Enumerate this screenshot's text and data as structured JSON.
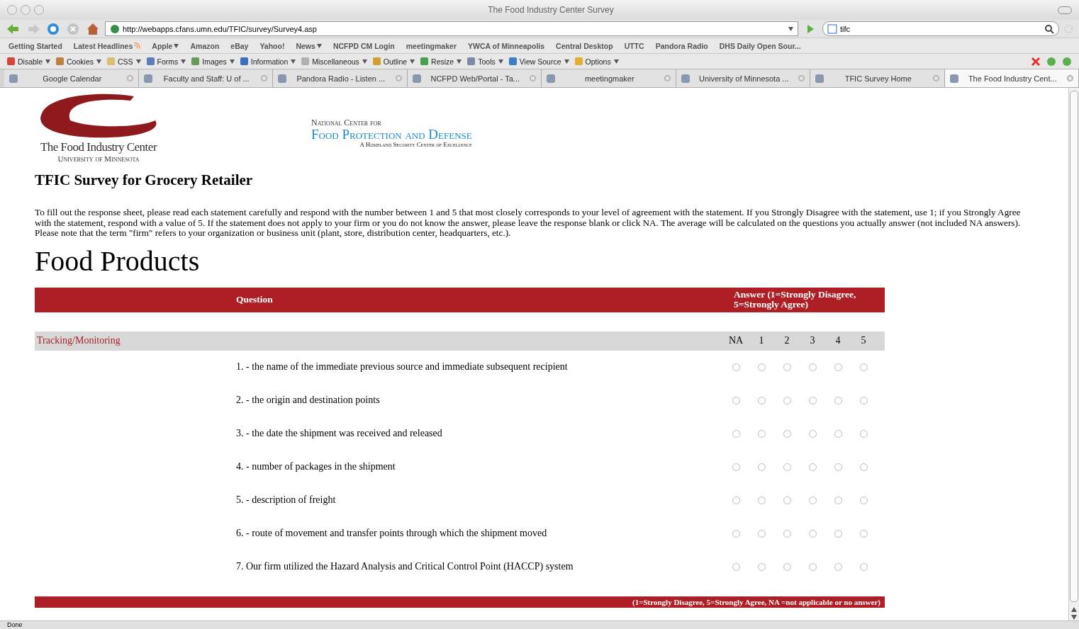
{
  "window": {
    "title": "The Food Industry Center Survey"
  },
  "navbar": {
    "url": "http://webapps.cfans.umn.edu/TFIC/survey/Survey4.asp",
    "search_value": "tifc"
  },
  "bookmarks": [
    {
      "label": "Getting Started",
      "menu": false
    },
    {
      "label": "Latest Headlines",
      "menu": false,
      "feed": true
    },
    {
      "label": "Apple",
      "menu": true
    },
    {
      "label": "Amazon",
      "menu": false
    },
    {
      "label": "eBay",
      "menu": false
    },
    {
      "label": "Yahoo!",
      "menu": false
    },
    {
      "label": "News",
      "menu": true
    },
    {
      "label": "NCFPD CM Login",
      "menu": false
    },
    {
      "label": "meetingmaker",
      "menu": false
    },
    {
      "label": "YWCA of Minneapolis",
      "menu": false
    },
    {
      "label": "Central Desktop",
      "menu": false
    },
    {
      "label": "UTTC",
      "menu": false
    },
    {
      "label": "Pandora Radio",
      "menu": false
    },
    {
      "label": "DHS Daily Open Sour...",
      "menu": false
    }
  ],
  "dev_toolbar": [
    {
      "label": "Disable",
      "color": "#d9443a"
    },
    {
      "label": "Cookies",
      "color": "#c08040"
    },
    {
      "label": "CSS",
      "color": "#d8c070"
    },
    {
      "label": "Forms",
      "color": "#5a7fb8"
    },
    {
      "label": "Images",
      "color": "#6a9a5a"
    },
    {
      "label": "Information",
      "color": "#3a70c0"
    },
    {
      "label": "Miscellaneous",
      "color": "#b0b0b0"
    },
    {
      "label": "Outline",
      "color": "#d0a030"
    },
    {
      "label": "Resize",
      "color": "#4aa050"
    },
    {
      "label": "Tools",
      "color": "#7a8aa8"
    },
    {
      "label": "View Source",
      "color": "#3a80c8"
    },
    {
      "label": "Options",
      "color": "#e0b030"
    }
  ],
  "tabs": [
    {
      "label": "Google Calendar",
      "selected": false
    },
    {
      "label": "Faculty and Staff: U of ...",
      "selected": false
    },
    {
      "label": "Pandora Radio - Listen ...",
      "selected": false
    },
    {
      "label": "NCFPD Web/Portal - Ta...",
      "selected": false
    },
    {
      "label": "meetingmaker",
      "selected": false
    },
    {
      "label": "University of Minnesota ...",
      "selected": false
    },
    {
      "label": "TFIC Survey Home",
      "selected": false
    },
    {
      "label": "The Food Industry Cent...",
      "selected": true
    }
  ],
  "page": {
    "logo_left": {
      "line1": "The Food Industry Center",
      "line2": "University of Minnesota"
    },
    "logo_right": {
      "line1": "National Center for",
      "line2": "Food Protection and Defense",
      "line3": "A Homeland Security Center of Excellence"
    },
    "title": "TFIC Survey for Grocery Retailer",
    "instructions": "To fill out the response sheet, please read each statement carefully and respond with the number between 1 and 5 that most closely corresponds to your level of agreement with the statement. If you Strongly Disagree with the statement, use 1; if you Strongly Agree with the statement, respond with a value of 5. If the statement does not apply to your firm or you do not know the answer, please leave the response blank or click NA. The average will be calculated on the questions you actually answer (not included NA answers). Please note that the term \"firm\" refers to your organization or business unit (plant, store, distribution center, headquarters, etc.).",
    "section": "Food Products",
    "table": {
      "columns": [
        "Question",
        "Answer (1=Strongly Disagree, 5=Strongly Agree)"
      ],
      "category": "Tracking/Monitoring",
      "scale": [
        "NA",
        "1",
        "2",
        "3",
        "4",
        "5"
      ],
      "questions": [
        {
          "text": "1. - the name of the immediate previous source and immediate subsequent recipient",
          "choices": [
            {
              "selected": false
            },
            {
              "selected": false
            },
            {
              "selected": false
            },
            {
              "selected": false
            },
            {
              "selected": false
            },
            {
              "selected": false
            }
          ]
        },
        {
          "text": "2. - the origin and destination points",
          "choices": [
            {
              "selected": false
            },
            {
              "selected": false
            },
            {
              "selected": false
            },
            {
              "selected": false
            },
            {
              "selected": false
            },
            {
              "selected": false
            }
          ]
        },
        {
          "text": "3. - the date the shipment was received and released",
          "choices": [
            {
              "selected": false
            },
            {
              "selected": false
            },
            {
              "selected": false
            },
            {
              "selected": false
            },
            {
              "selected": false
            },
            {
              "selected": false
            }
          ]
        },
        {
          "text": "4. - number of packages in the shipment",
          "choices": [
            {
              "selected": false
            },
            {
              "selected": false
            },
            {
              "selected": false
            },
            {
              "selected": false
            },
            {
              "selected": false
            },
            {
              "selected": false
            }
          ]
        },
        {
          "text": "5. - description of freight",
          "choices": [
            {
              "selected": false
            },
            {
              "selected": false
            },
            {
              "selected": false
            },
            {
              "selected": false
            },
            {
              "selected": false
            },
            {
              "selected": false
            }
          ]
        },
        {
          "text": "6. - route of movement and transfer points through which the shipment moved",
          "choices": [
            {
              "selected": false
            },
            {
              "selected": false
            },
            {
              "selected": false
            },
            {
              "selected": false
            },
            {
              "selected": false
            },
            {
              "selected": false
            }
          ]
        },
        {
          "text": "7. Our firm utilized the Hazard Analysis and Critical Control Point (HACCP) system",
          "choices": [
            {
              "selected": false
            },
            {
              "selected": false
            },
            {
              "selected": false
            },
            {
              "selected": false
            },
            {
              "selected": false
            },
            {
              "selected": false
            }
          ]
        }
      ],
      "footer_legend": "(1=Strongly Disagree, 5=Strongly Agree, NA =not applicable or no answer)"
    }
  },
  "status_bar": "Done"
}
